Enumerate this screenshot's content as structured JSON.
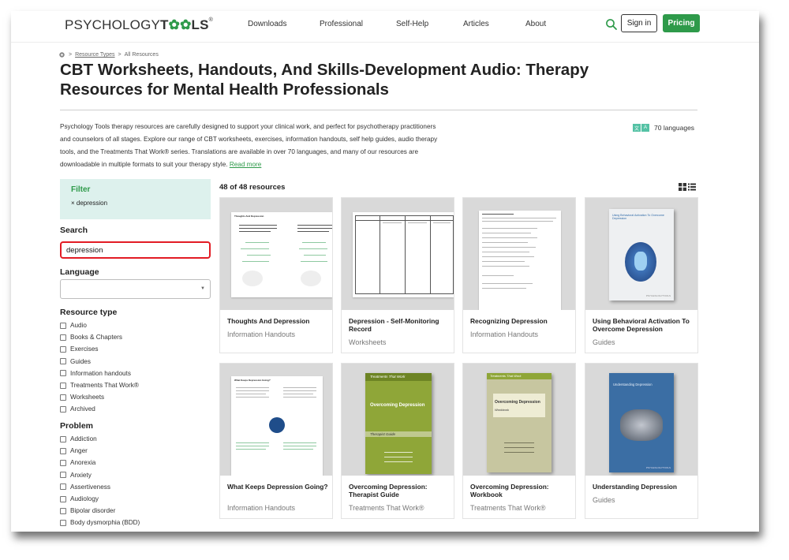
{
  "header": {
    "logo": {
      "part1": "PSYCHOLOGY",
      "part2": "T",
      "gear1": "✿",
      "gear2": "✿",
      "part3": "LS",
      "reg": "®"
    },
    "nav": [
      "Downloads",
      "Professional",
      "Self-Help",
      "Articles",
      "About"
    ],
    "signin_label": "Sign in",
    "pricing_label": "Pricing",
    "search_icon": "search-icon",
    "accent_color": "#2e9a4a"
  },
  "breadcrumb": {
    "sep1": ">",
    "link": "Resource Types",
    "sep2": ">",
    "current": "All Resources"
  },
  "page_title": "CBT Worksheets, Handouts, And Skills-Development Audio: Therapy Resources for Mental Health Professionals",
  "intro": {
    "text": "Psychology Tools therapy resources are carefully designed to support your clinical work, and perfect for psychotherapy practitioners and counselors of all stages. Explore our range of CBT worksheets, exercises, information handouts, self help guides, audio therapy tools, and the Treatments That Work® series. Translations are available in over 70 languages, and many of our resources are downloadable in multiple formats to suit your therapy style.",
    "read_more": "Read more"
  },
  "languages_badge": {
    "icon1": "文",
    "icon2": "A",
    "label": "70 languages"
  },
  "sidebar": {
    "filter_title": "Filter",
    "active_filter": "× depression",
    "search_label": "Search",
    "search_value": "depression",
    "language_label": "Language",
    "language_value": "",
    "resource_type_label": "Resource type",
    "resource_types": [
      "Audio",
      "Books & Chapters",
      "Exercises",
      "Guides",
      "Information handouts",
      "Treatments That Work®",
      "Worksheets",
      "Archived"
    ],
    "problem_label": "Problem",
    "problems": [
      "Addiction",
      "Anger",
      "Anorexia",
      "Anxiety",
      "Assertiveness",
      "Audiology",
      "Bipolar disorder",
      "Body dysmorphia (BDD)"
    ]
  },
  "results": {
    "count": "48 of 48 resources",
    "cards": [
      {
        "title": "Thoughts And Depression",
        "category": "Information Handouts"
      },
      {
        "title": "Depression - Self-Monitoring Record",
        "category": "Worksheets"
      },
      {
        "title": "Recognizing Depression",
        "category": "Information Handouts"
      },
      {
        "title": "Using Behavioral Activation To Overcome Depression",
        "category": "Guides"
      },
      {
        "title": "What Keeps Depression Going?",
        "category": "Information Handouts"
      },
      {
        "title": "Overcoming Depression: Therapist Guide",
        "category": "Treatments That Work®"
      },
      {
        "title": "Overcoming Depression: Workbook",
        "category": "Treatments That Work®"
      },
      {
        "title": "Understanding Depression",
        "category": "Guides"
      }
    ]
  },
  "thumb_text": {
    "t1_title": "Thoughts And Depression",
    "t5_title": "What Keeps Depression Going?",
    "t4_title": "Using Behavioral Activation To Overcome Depression",
    "t8_title": "Understanding Depression",
    "t6_series": "Treatments That Work",
    "t6_title": "Overcoming Depression",
    "t6_sub": "Therapist Guide",
    "t7_series": "Treatments That Work",
    "t7_title": "Overcoming Depression",
    "t7_sub": "Workbook",
    "brand": "PSYCHOLOGYTOOLS"
  }
}
